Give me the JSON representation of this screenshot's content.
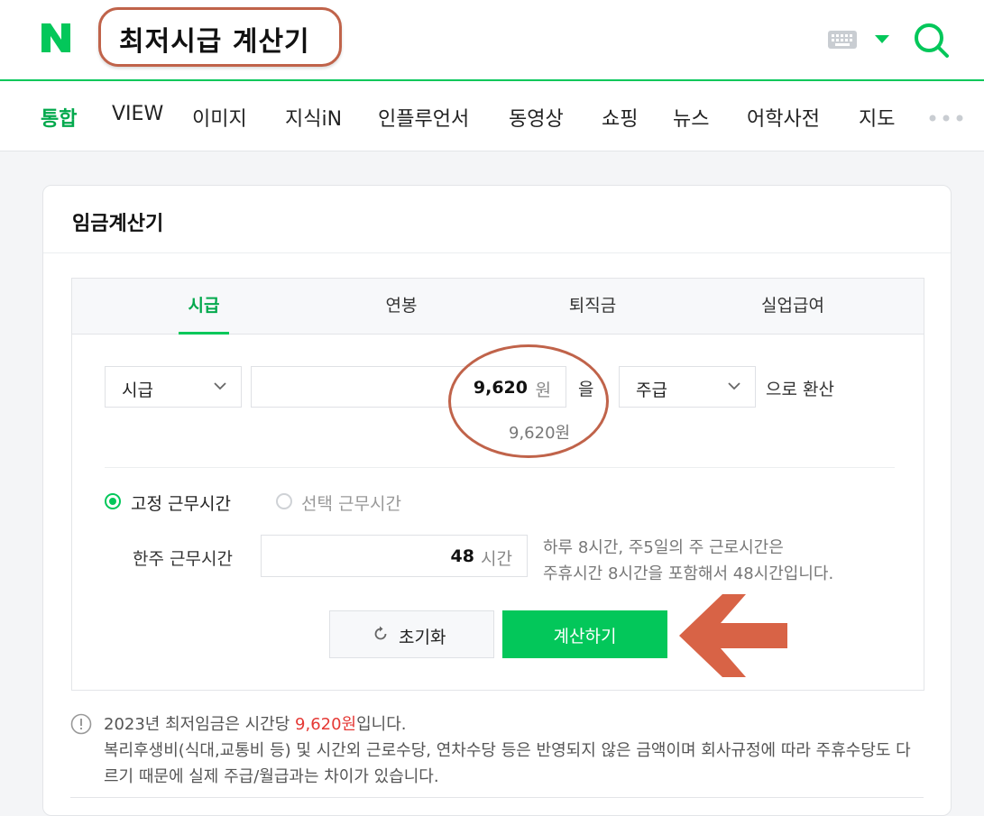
{
  "header": {
    "logo": "N",
    "search_query": "최저시급 계산기",
    "keyboard_icon": "keyboard-icon",
    "search_icon": "search-icon"
  },
  "nav": {
    "items": [
      {
        "label": "통합",
        "active": true
      },
      {
        "label": "VIEW"
      },
      {
        "label": "이미지"
      },
      {
        "label": "지식iN"
      },
      {
        "label": "인플루언서"
      },
      {
        "label": "동영상"
      },
      {
        "label": "쇼핑"
      },
      {
        "label": "뉴스"
      },
      {
        "label": "어학사전"
      },
      {
        "label": "지도"
      }
    ],
    "more_icon": "more-dots-icon"
  },
  "card": {
    "title": "임금계산기",
    "tabs": [
      {
        "label": "시급",
        "active": true
      },
      {
        "label": "연봉"
      },
      {
        "label": "퇴직금"
      },
      {
        "label": "실업급여"
      }
    ],
    "from_unit_select": "시급",
    "amount_value": "9,620",
    "amount_unit": "원",
    "particle": "을",
    "to_unit_select": "주급",
    "convert_suffix": "으로 환산",
    "amount_readout": "9,620원",
    "radio_fixed": "고정 근무시간",
    "radio_select": "선택 근무시간",
    "weekly_hours_label": "한주 근무시간",
    "hours_value": "48",
    "hours_unit": "시간",
    "hint_line1": "하루 8시간, 주5일의 주 근로시간은",
    "hint_line2": "주휴시간 8시간을 포함해서 48시간입니다.",
    "reset_label": "초기화",
    "calculate_label": "계산하기",
    "notice_prefix": "2023년 최저임금은 시간당 ",
    "notice_highlight": "9,620원",
    "notice_suffix": "입니다.",
    "notice_body": "복리후생비(식대,교통비 등) 및 시간외 근로수당, 연차수당 등은 반영되지 않은 금액이며 회사규정에 따라 주휴수당도 다르기 때문에 실제 주급/월급과는 차이가 있습니다."
  },
  "colors": {
    "brand_green": "#03c75a",
    "annotation": "#c0634a",
    "highlight_red": "#e53935"
  }
}
